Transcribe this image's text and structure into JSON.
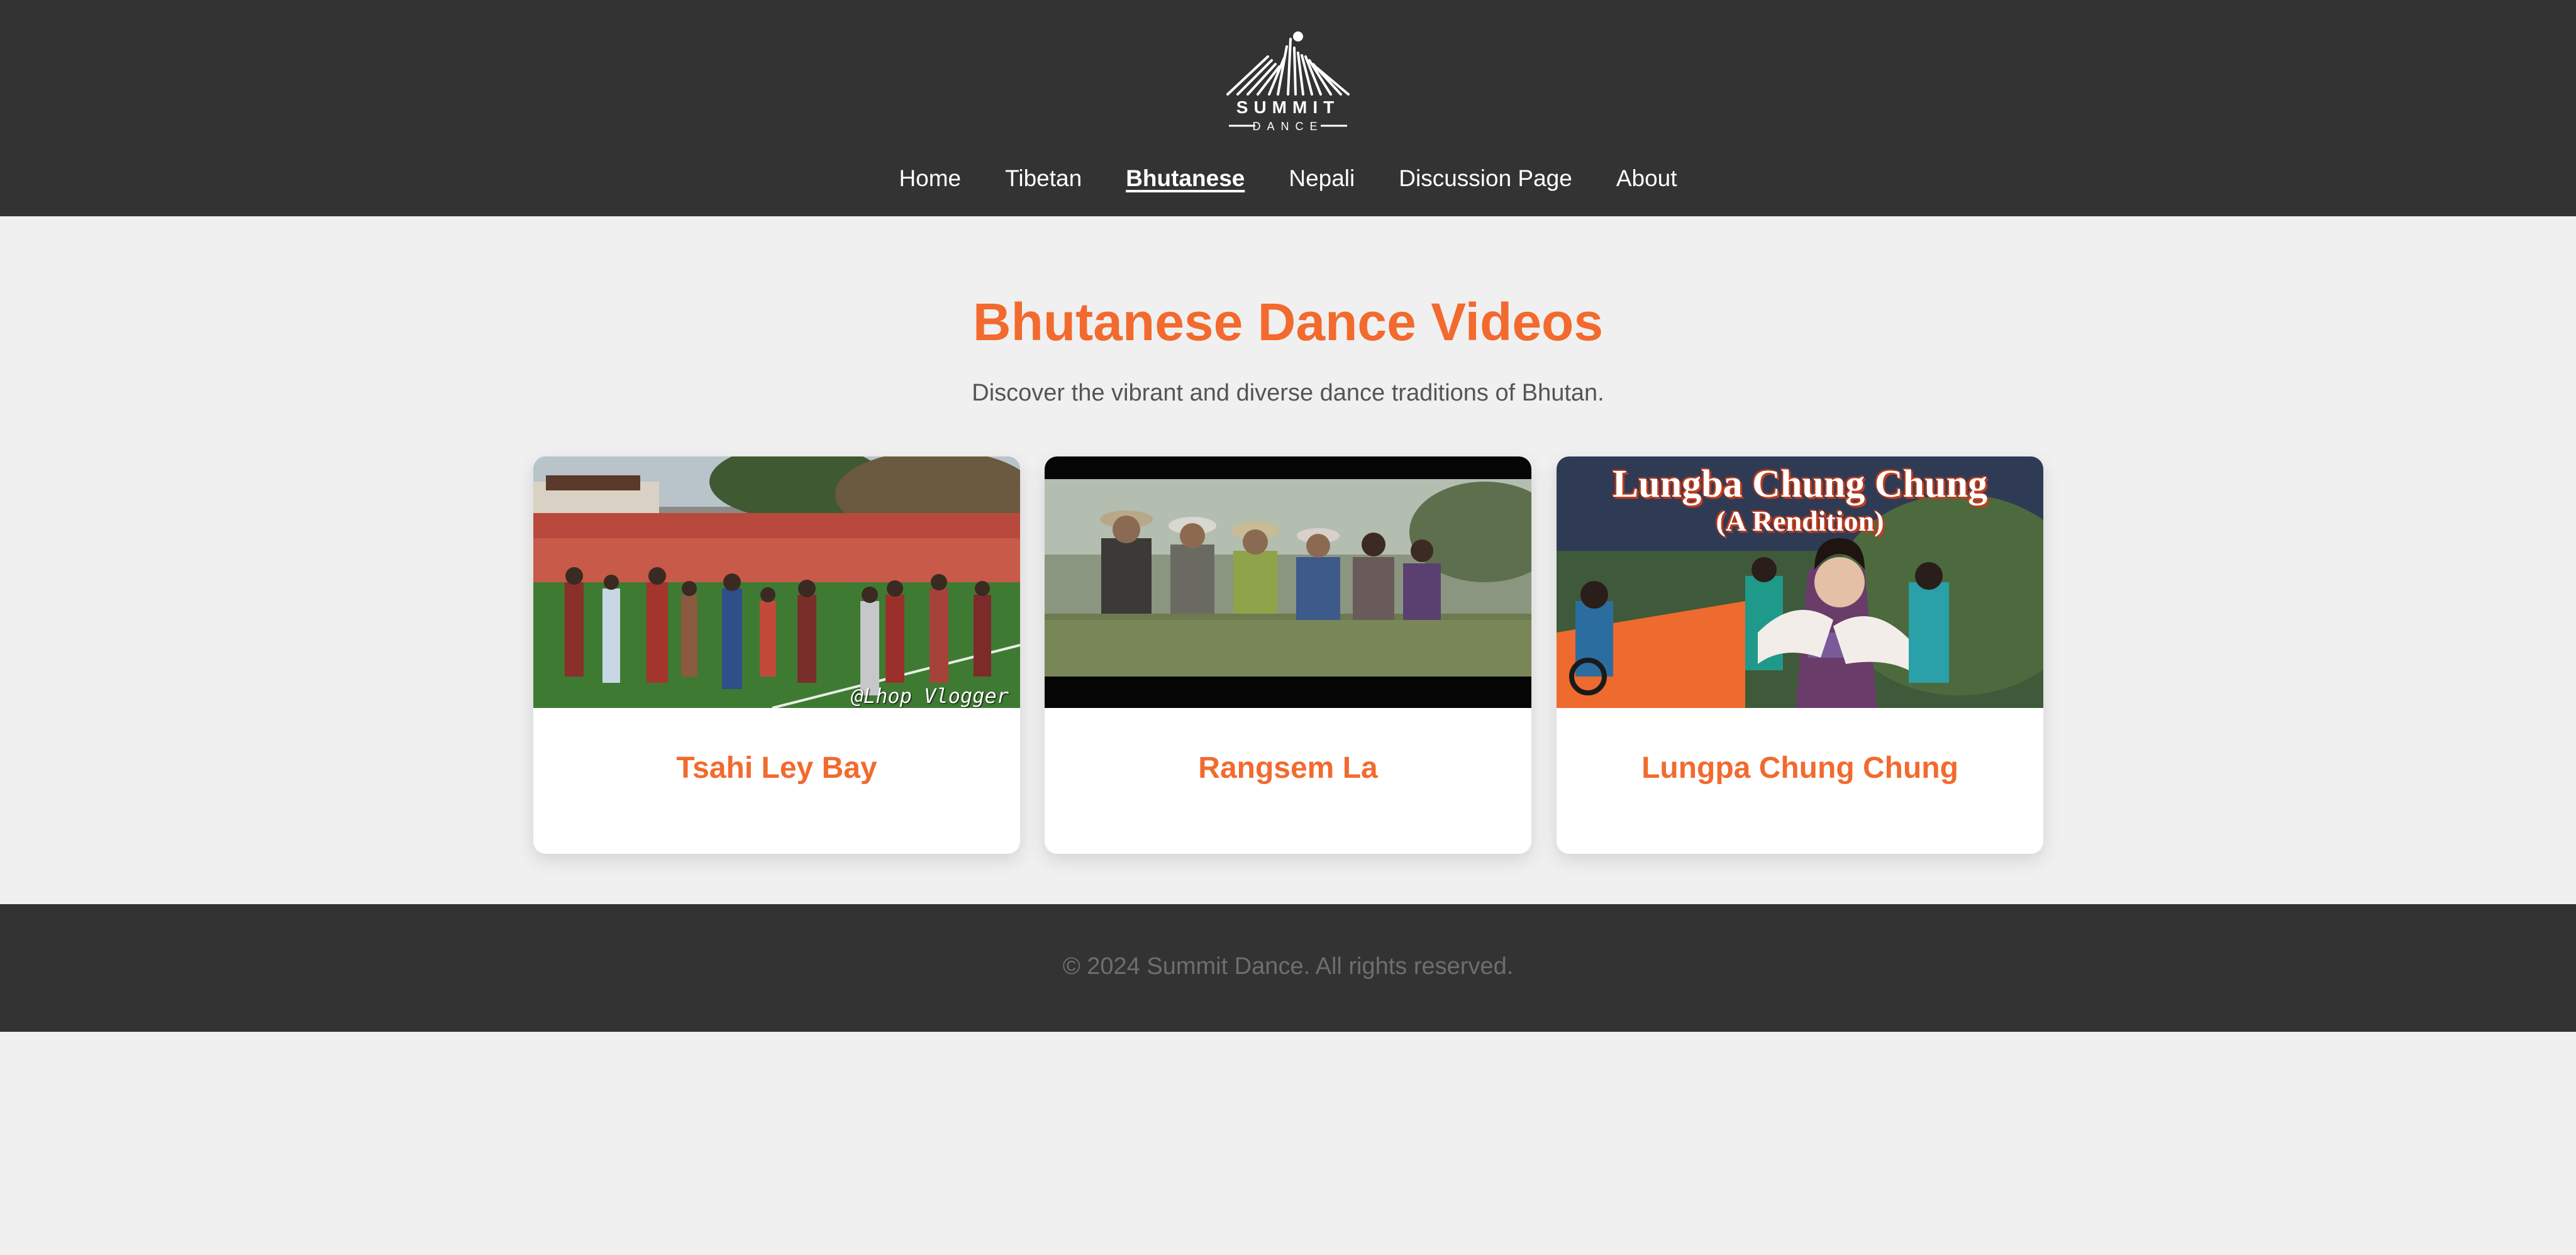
{
  "header": {
    "logo": {
      "name": "SUMMIT",
      "tagline": "DANCE"
    },
    "nav": [
      {
        "label": "Home"
      },
      {
        "label": "Tibetan"
      },
      {
        "label": "Bhutanese",
        "active": true
      },
      {
        "label": "Nepali"
      },
      {
        "label": "Discussion Page"
      },
      {
        "label": "About"
      }
    ]
  },
  "main": {
    "title": "Bhutanese Dance Videos",
    "subtitle": "Discover the vibrant and diverse dance traditions of Bhutan.",
    "videos": [
      {
        "title": "Tsahi Ley Bay",
        "thumbnail_watermark": "@Lhop Vlogger"
      },
      {
        "title": "Rangsem La"
      },
      {
        "title": "Lungpa Chung Chung",
        "thumbnail_heading": "Lungba Chung Chung",
        "thumbnail_subheading": "(A Rendition)"
      }
    ]
  },
  "footer": {
    "copyright": "© 2024 Summit Dance. All rights reserved."
  },
  "colors": {
    "header_bg": "#333333",
    "accent": "#f26a2e",
    "page_bg": "#f0f0f0",
    "card_bg": "#ffffff"
  }
}
